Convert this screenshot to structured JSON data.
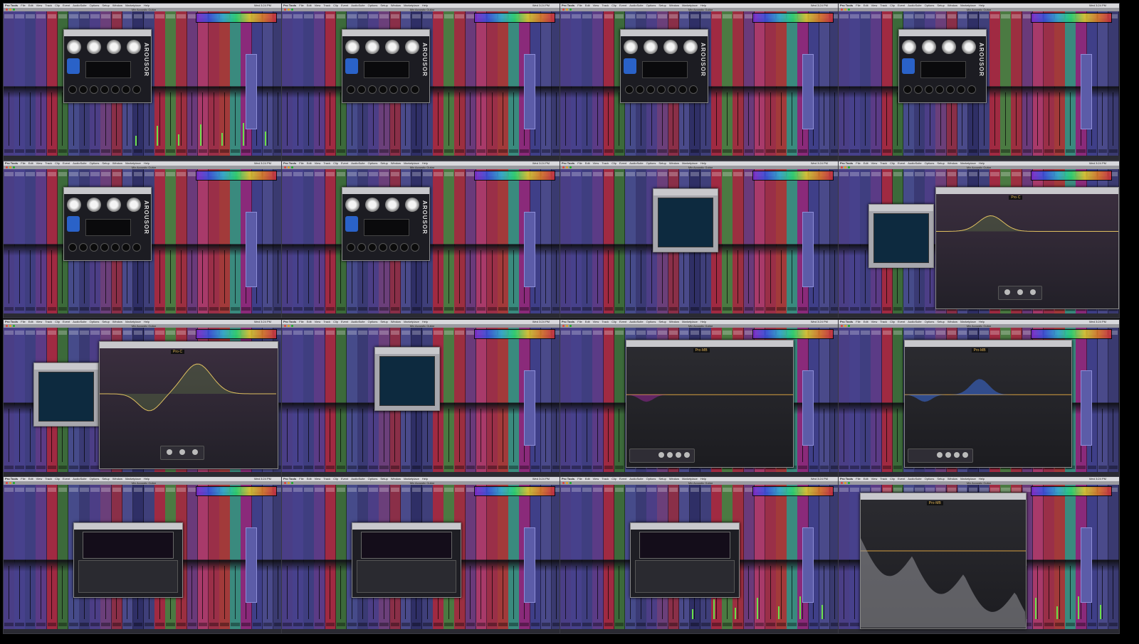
{
  "window_title": "Mix Acoustic Guitar",
  "menubar": {
    "app": "Pro Tools",
    "items": [
      "File",
      "Edit",
      "View",
      "Track",
      "Clip",
      "Event",
      "AudioSuite",
      "Options",
      "Setup",
      "Window",
      "Marketplace",
      "Help"
    ],
    "clock": "Wed 3:24 PM"
  },
  "plugins": {
    "arouser_brand": "AROUSOR",
    "eq_brand_c": "Pro·C",
    "eq_brand_mb": "Pro·MB"
  },
  "colors": {
    "background": "#000000",
    "meter": "#6ae04a",
    "tracks": [
      "#4a3e86",
      "#47418c",
      "#3f3e80",
      "#5b3b86",
      "#a02a42",
      "#3c6a3a",
      "#464b8a",
      "#3a3a74",
      "#4c3e86",
      "#6b3f7a",
      "#8a2f48",
      "#4a4a8a",
      "#2f2f66",
      "#3f3f7a",
      "#a02a42",
      "#4b7a42",
      "#9c2f40",
      "#6a3a7a",
      "#a83a6a",
      "#9a2f48",
      "#a23a3a",
      "#3a8a7e",
      "#8a2a7a",
      "#3f3f88",
      "#4a4a8a",
      "#3a3a70"
    ]
  },
  "tiles": [
    {
      "overlay": "arousor",
      "meters": true
    },
    {
      "overlay": "arousor",
      "meters": false
    },
    {
      "overlay": "arousor",
      "meters": false
    },
    {
      "overlay": "arousor",
      "meters": false
    },
    {
      "overlay": "arousor",
      "meters": false
    },
    {
      "overlay": "arousor",
      "meters": false
    },
    {
      "overlay": "frame",
      "meters": false
    },
    {
      "overlay": "frame+eq-c",
      "meters": false
    },
    {
      "overlay": "frame+eq-c-large",
      "meters": false
    },
    {
      "overlay": "frame",
      "meters": false
    },
    {
      "overlay": "eq-mb",
      "meters": false
    },
    {
      "overlay": "eq-mb-bell",
      "meters": false
    },
    {
      "overlay": "maxx",
      "meters": false
    },
    {
      "overlay": "maxx",
      "meters": false
    },
    {
      "overlay": "maxx",
      "meters": true
    },
    {
      "overlay": "eq-mb-large",
      "meters": true
    }
  ]
}
